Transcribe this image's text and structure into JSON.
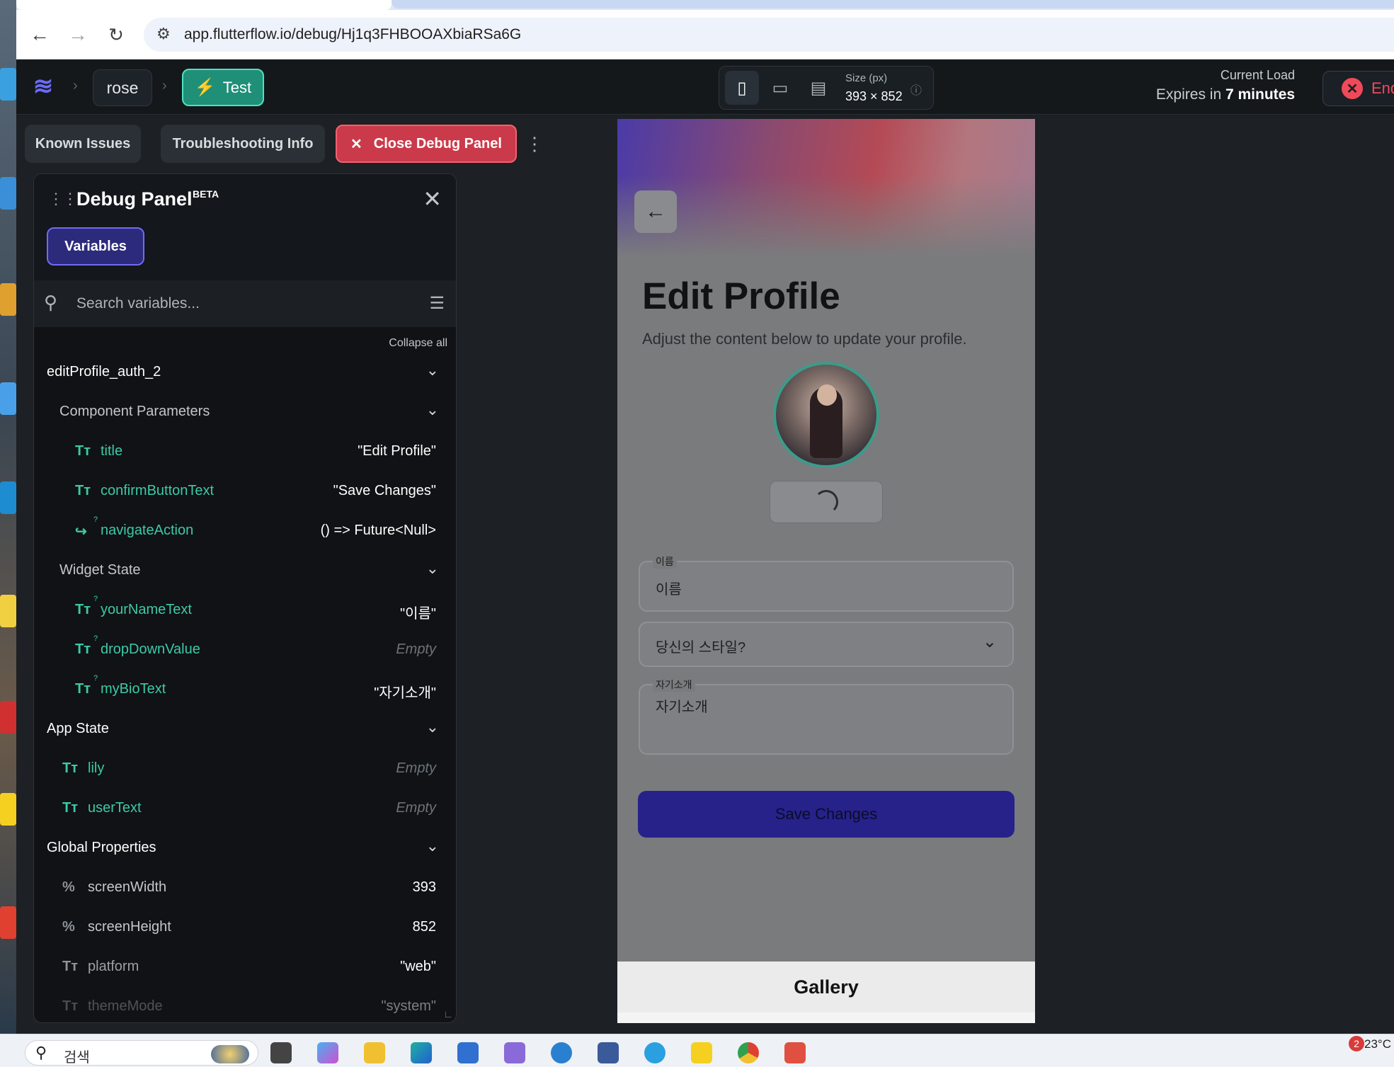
{
  "browser": {
    "url": "app.flutterflow.io/debug/Hj1q3FHBOOAXbiaRSa6G"
  },
  "header": {
    "project_name": "rose",
    "test_label": "Test",
    "size_label": "Size (px)",
    "size_value": "393 × 852",
    "load_label": "Current Load",
    "load_expires_prefix": "Expires in",
    "load_expires_value": "7 minutes",
    "end_label": "End S"
  },
  "toolbar": {
    "known_issues": "Known Issues",
    "troubleshooting": "Troubleshooting Info",
    "close_debug": "Close Debug Panel"
  },
  "debug_panel": {
    "title": "Debug Panel",
    "beta": "BETA",
    "tab_variables": "Variables",
    "search_placeholder": "Search variables...",
    "collapse_all": "Collapse all",
    "widget_name": "editProfile_auth_2",
    "component_params_label": "Component Parameters",
    "component_params": [
      {
        "name": "title",
        "value": "\"Edit Profile\""
      },
      {
        "name": "confirmButtonText",
        "value": "\"Save Changes\""
      },
      {
        "name": "navigateAction",
        "value": "() => Future<Null>"
      }
    ],
    "widget_state_label": "Widget State",
    "widget_state": [
      {
        "name": "yourNameText",
        "value": "\"이름\""
      },
      {
        "name": "dropDownValue",
        "value": "Empty"
      },
      {
        "name": "myBioText",
        "value": "\"자기소개\""
      }
    ],
    "app_state_label": "App State",
    "app_state": [
      {
        "name": "lily",
        "value": "Empty"
      },
      {
        "name": "userText",
        "value": "Empty"
      }
    ],
    "global_props_label": "Global Properties",
    "global_props": [
      {
        "name": "screenWidth",
        "value": "393"
      },
      {
        "name": "screenHeight",
        "value": "852"
      },
      {
        "name": "platform",
        "value": "\"web\""
      },
      {
        "name": "themeMode",
        "value": "\"system\""
      }
    ]
  },
  "phone": {
    "title": "Edit Profile",
    "subtitle": "Adjust the content below to update your profile.",
    "name_label": "이름",
    "name_value": "이름",
    "dropdown_value": "당신의 스타일?",
    "bio_label": "자기소개",
    "bio_value": "자기소개",
    "save_button": "Save Changes",
    "gallery": "Gallery"
  },
  "taskbar": {
    "search_text": "검색",
    "temperature": "23°C",
    "badge": "2"
  },
  "colors": {
    "accent": "#3dc9a8",
    "danger": "#cb3a4a",
    "primary": "#26228a"
  }
}
